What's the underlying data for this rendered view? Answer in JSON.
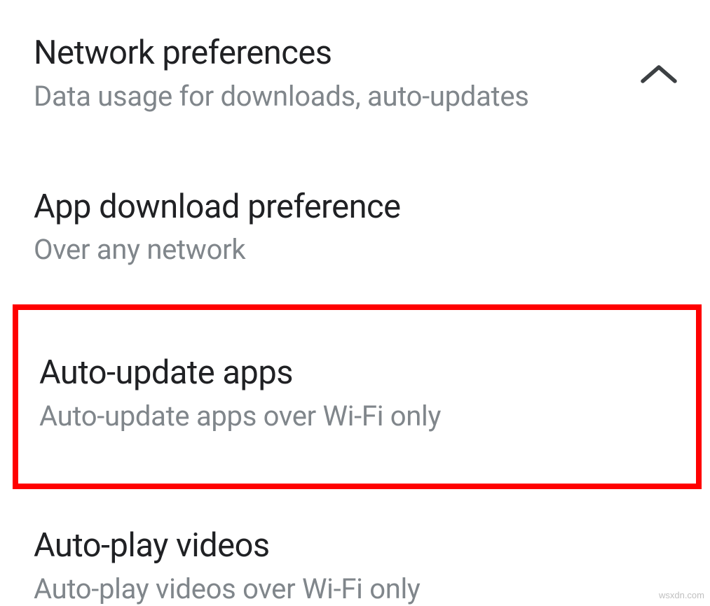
{
  "header": {
    "title": "Network preferences",
    "subtitle": "Data usage for downloads, auto-updates"
  },
  "items": [
    {
      "title": "App download preference",
      "subtitle": "Over any network"
    },
    {
      "title": "Auto-update apps",
      "subtitle": "Auto-update apps over Wi-Fi only"
    },
    {
      "title": "Auto-play videos",
      "subtitle": "Auto-play videos over Wi-Fi only"
    }
  ],
  "watermark": "wsxdn.com"
}
